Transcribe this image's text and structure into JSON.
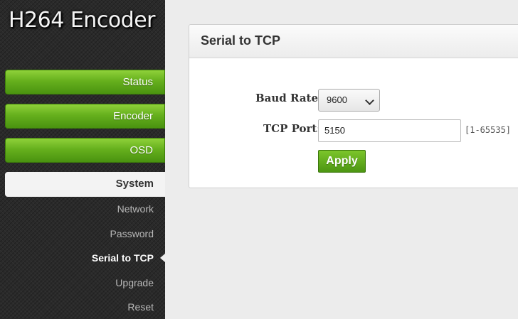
{
  "app": {
    "title": "H264 Encoder"
  },
  "nav": {
    "status": "Status",
    "encoder": "Encoder",
    "osd": "OSD",
    "system": "System",
    "sub_items": [
      "Network",
      "Password",
      "Serial to TCP",
      "Upgrade",
      "Reset"
    ],
    "current_sub": "Serial to TCP"
  },
  "panel": {
    "title": "Serial to TCP",
    "baud_rate_label": "Baud Rate:",
    "baud_rate_value": "9600",
    "tcp_port_label": "TCP Port:",
    "tcp_port_value": "5150",
    "tcp_port_range": "[1-65535]",
    "apply_label": "Apply"
  },
  "colors": {
    "accent_green": "#66b01d",
    "sidebar_bg": "#2a2a2a",
    "page_bg": "#ececec"
  }
}
